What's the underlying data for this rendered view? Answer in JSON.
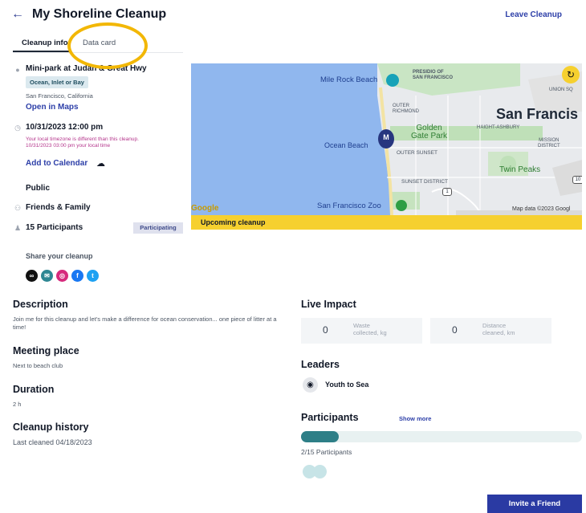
{
  "header": {
    "back_icon": "back-arrow-icon",
    "title": "My Shoreline Cleanup",
    "leave_label": "Leave Cleanup"
  },
  "tabs": [
    {
      "label": "Cleanup info",
      "active": true
    },
    {
      "label": "Data card",
      "active": false
    }
  ],
  "location": {
    "name": "Mini-park at Judah & Great Hwy",
    "water_type": "Ocean, Inlet or Bay",
    "city": "San Francisco, California",
    "open_maps": "Open in Maps"
  },
  "datetime": {
    "value": "10/31/2023 12:00 pm",
    "warning_line1": "Your local timezone is different than this cleanup.",
    "warning_line2": "10/31/2023 03:00 pm your local time",
    "add_calendar": "Add to Calendar"
  },
  "visibility": "Public",
  "audience": "Friends & Family",
  "participants_count": "15 Participants",
  "participating_badge": "Participating",
  "map": {
    "labels": {
      "mile_rock": "Mile Rock Beach",
      "presidio": "PRESIDIO OF\nSAN FRANCISCO",
      "outer_richmond": "OUTER\nRICHMOND",
      "sf": "San Francis",
      "golden_gate": "Golden\nGate Park",
      "haight": "HAIGHT-ASHBURY",
      "ocean_beach": "Ocean Beach",
      "outer_sunset": "OUTER SUNSET",
      "mission": "MISSION\nDISTRICT",
      "twin_peaks": "Twin Peaks",
      "sunset_district": "SUNSET DISTRICT",
      "sf_zoo": "San Francisco Zoo",
      "union": "UNION SQ",
      "google": "Google",
      "map_data": "Map data ©2023 Googl",
      "marker": "M",
      "route": "1",
      "hwy": "10"
    },
    "status_banner": "Upcoming cleanup"
  },
  "share": {
    "title": "Share your cleanup",
    "icons": [
      {
        "name": "link-icon",
        "glyph": "🔗",
        "color": "#111111"
      },
      {
        "name": "email-icon",
        "glyph": "✉",
        "color": "#2e8793"
      },
      {
        "name": "instagram-icon",
        "glyph": "◎",
        "color": "#d62a7c"
      },
      {
        "name": "facebook-icon",
        "glyph": "f",
        "color": "#1877f2"
      },
      {
        "name": "twitter-icon",
        "glyph": "t",
        "color": "#1da1f2"
      }
    ]
  },
  "description": {
    "title": "Description",
    "text": "Join me for this cleanup and let's make a difference for ocean conservation... one piece of litter at a time!"
  },
  "meeting_place": {
    "title": "Meeting place",
    "text": "Next to beach club"
  },
  "duration": {
    "title": "Duration",
    "text": "2 h"
  },
  "history": {
    "title": "Cleanup history",
    "text": "Last cleaned 04/18/2023"
  },
  "impact": {
    "title": "Live Impact",
    "waste": {
      "value": "0",
      "label1": "Waste",
      "label2": "collected, kg"
    },
    "distance": {
      "value": "0",
      "label1": "Distance",
      "label2": "cleaned, km"
    }
  },
  "leaders": {
    "title": "Leaders",
    "name": "Youth to Sea"
  },
  "participants": {
    "title": "Participants",
    "show_more": "Show more",
    "count_text": "2/15 Participants",
    "progress": 0.1333
  },
  "invite_label": "Invite a Friend",
  "colors": {
    "accent": "#2a3aa3",
    "highlight": "#f2b705",
    "banner": "#f6d02f",
    "progress": "#2e7f87"
  }
}
